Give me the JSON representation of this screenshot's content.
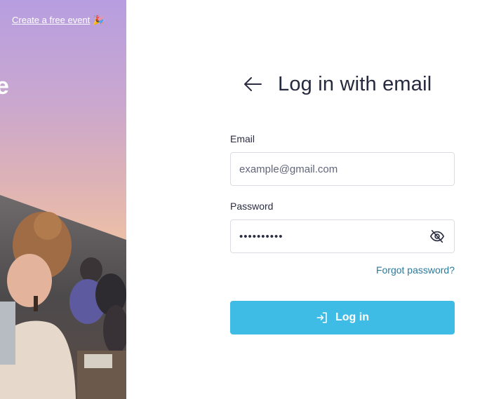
{
  "promo": {
    "create_event_link": "Create a free event",
    "party_icon": "🎉",
    "headline_fragment": "e"
  },
  "login": {
    "title": "Log in with email",
    "email_label": "Email",
    "email_placeholder": "example@gmail.com",
    "email_value": "",
    "password_label": "Password",
    "password_masked": "••••••••••",
    "forgot_password": "Forgot password?",
    "submit_label": "Log in"
  },
  "icons": {
    "back": "arrow-left-icon",
    "visibility": "eye-off-icon",
    "submit": "log-in-icon",
    "party": "party-popper-icon"
  },
  "colors": {
    "accent": "#3fbce6",
    "link": "#2a7a9b",
    "title": "#262a3e"
  }
}
